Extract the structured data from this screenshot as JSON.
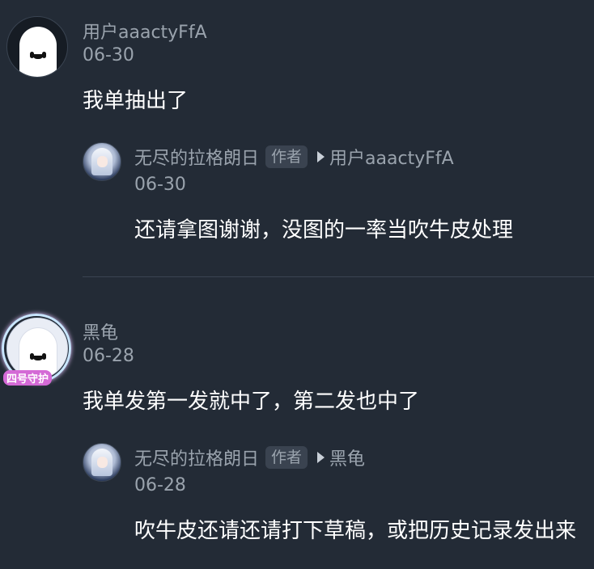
{
  "comments": [
    {
      "username": "用户aaactyFfA",
      "date": "06-30",
      "content": "我单抽出了",
      "reply": {
        "username": "无尽的拉格朗日",
        "badge": "作者",
        "reply_to": "用户aaactyFfA",
        "date": "06-30",
        "content": "还请拿图谢谢，没图的一率当吹牛皮处理"
      }
    },
    {
      "username": "黑龟",
      "date": "06-28",
      "content": "我单发第一发就中了，第二发也中了",
      "avatar_frame_label": "四号守护",
      "reply": {
        "username": "无尽的拉格朗日",
        "badge": "作者",
        "reply_to": "黑龟",
        "date": "06-28",
        "content": "吹牛皮还请还请打下草稿，或把历史记录发出来"
      }
    }
  ],
  "icons": {
    "avatar": "ghost-avatar-icon",
    "reply_arrow": "play-arrow-icon"
  },
  "colors": {
    "background": "#232b36",
    "secondary_text": "#9aa3ad",
    "primary_text": "#ffffff"
  }
}
